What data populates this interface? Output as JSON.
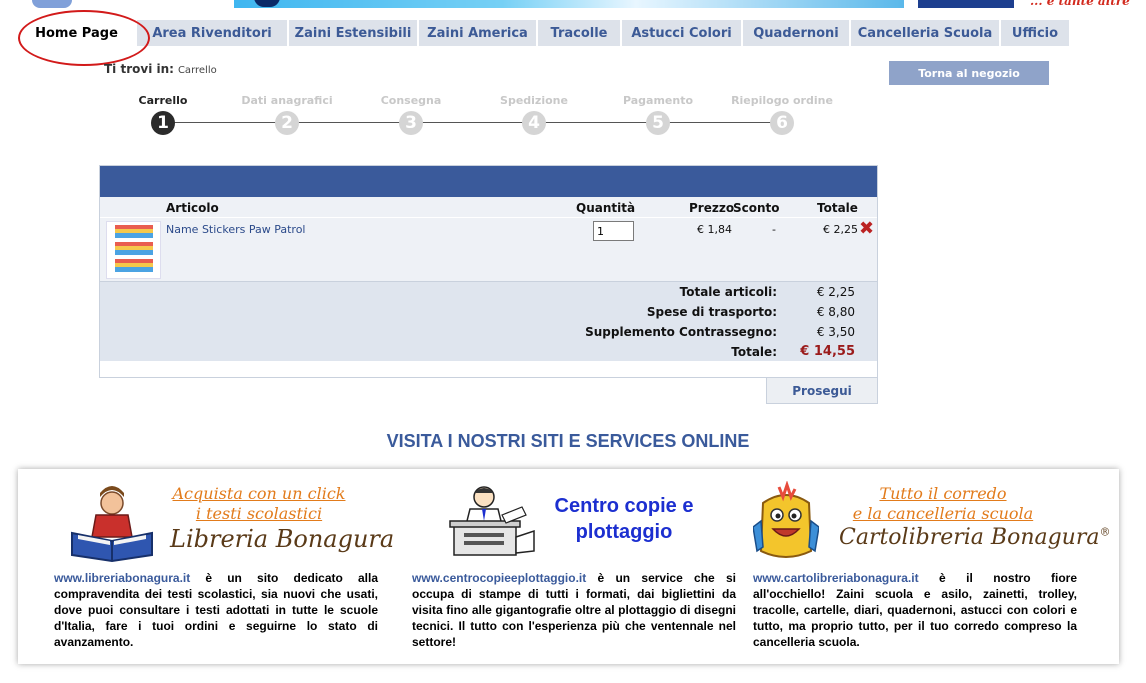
{
  "banner": {
    "tagline": "... e tante altre"
  },
  "nav": {
    "tabs": [
      {
        "label": "Home Page",
        "active": true
      },
      {
        "label": "Area Rivenditori"
      },
      {
        "label": "Zaini Estensibili"
      },
      {
        "label": "Zaini America"
      },
      {
        "label": "Tracolle"
      },
      {
        "label": "Astucci Colori"
      },
      {
        "label": "Quadernoni"
      },
      {
        "label": "Cancelleria Scuola"
      },
      {
        "label": "Ufficio"
      }
    ]
  },
  "breadcrumb": {
    "prefix": "Ti trovi in:",
    "current": "Carrello"
  },
  "back_button": "Torna al negozio",
  "steps": [
    {
      "label": "Carrello",
      "num": "1"
    },
    {
      "label": "Dati anagrafici",
      "num": "2"
    },
    {
      "label": "Consegna",
      "num": "3"
    },
    {
      "label": "Spedizione",
      "num": "4"
    },
    {
      "label": "Pagamento",
      "num": "5"
    },
    {
      "label": "Riepilogo ordine",
      "num": "6"
    }
  ],
  "cart": {
    "columns": {
      "article": "Articolo",
      "quantity": "Quantità",
      "price": "Prezzo",
      "discount": "Sconto",
      "total": "Totale"
    },
    "items": [
      {
        "name": "Name Stickers Paw Patrol",
        "quantity": "1",
        "price": "€ 1,84",
        "discount": "-",
        "total": "€ 2,25"
      }
    ],
    "summary": {
      "items_label": "Totale articoli:",
      "items_value": "€ 2,25",
      "shipping_label": "Spese di trasporto:",
      "shipping_value": "€ 8,80",
      "cod_label": "Supplemento Contrassegno:",
      "cod_value": "€ 3,50",
      "total_label": "Totale:",
      "total_value": "€ 14,55"
    },
    "proceed": "Prosegui"
  },
  "sites": {
    "title": "VISITA I NOSTRI SITI E SERVICES ONLINE",
    "libreria": {
      "tagline1": "Acquista con un click",
      "tagline2": "i testi scolastici",
      "brand": "Libreria Bonagura",
      "url": "www.libreriabonagura.it",
      "text": " è un sito dedicato alla compravendita dei testi scolastici, sia nuovi che usati, dove puoi consultare i testi adottati in tutte le scuole d'Italia, fare i tuoi ordini e seguirne lo stato di avanzamento."
    },
    "copie": {
      "title": "Centro copie e plottaggio",
      "url": "www.centrocopieeplottaggio.it",
      "text": " è un service che si occupa di stampe di tutti i formati, dai bigliettini da visita fino alle gigantografie oltre al plottaggio di disegni tecnici. Il tutto con l'esperienza più che ventennale nel settore!"
    },
    "cartolibreria": {
      "tagline1": "Tutto il corredo",
      "tagline2": "e la cancelleria scuola",
      "brand": "Cartolibreria Bonagura",
      "reg": "®",
      "url": "www.cartolibreriabonagura.it",
      "text": " è il nostro fiore all'occhiello! Zaini scuola e asilo, zainetti, trolley, tracolle, cartelle, diari, quadernoni, astucci con colori e tutto, ma proprio tutto, per il tuo corredo compreso la cancelleria scuola."
    }
  }
}
